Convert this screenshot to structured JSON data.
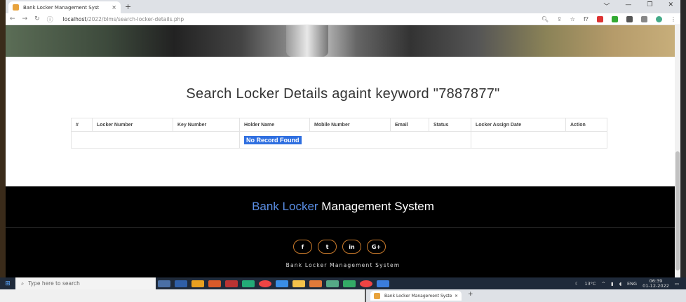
{
  "browser": {
    "tab_title": "Bank Locker Management Syst",
    "tab_close": "×",
    "new_tab": "+",
    "url_host": "localhost",
    "url_path": "/2022/blms/search-locker-details.php",
    "window_controls": [
      "﹀",
      "—",
      "❐",
      "✕"
    ],
    "toolbar_icons": [
      "zoom",
      "share",
      "star",
      "f?",
      "extensions",
      "menu"
    ]
  },
  "page": {
    "heading": "Search Locker Details againt keyword \"7887877\"",
    "table": {
      "headers": [
        "#",
        "Locker Number",
        "Key Number",
        "Holder Name",
        "Mobile Number",
        "Email",
        "Status",
        "Locker Assign Date",
        "Action"
      ],
      "empty_message": "No Record Found"
    }
  },
  "footer": {
    "brand_blue": "Bank Locker",
    "brand_white": " Management System",
    "socials": [
      "f",
      "t",
      "in",
      "G+"
    ],
    "subtitle": "Bank Locker Management System"
  },
  "taskbar": {
    "search_placeholder": "Type here to search",
    "weather": "13°C",
    "lang": "ENG",
    "time": "06:39",
    "date": "01-12-2022"
  },
  "peek_window": {
    "tab_title": "Bank Locker Management Syste",
    "tab_close": "×",
    "new_tab": "+"
  }
}
